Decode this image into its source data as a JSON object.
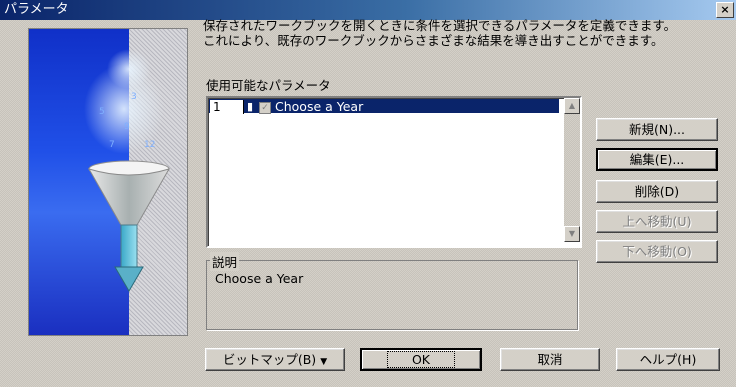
{
  "window": {
    "title": "パラメータ",
    "close_glyph": "×"
  },
  "description": {
    "line1": "保存されたワークブックを開くときに条件を選択できるパラメータを定義できます。",
    "line2": "これにより、既存のワークブックからさまざまな結果を導き出すことができます。"
  },
  "params_list": {
    "label": "使用可能なパラメータ",
    "rows": [
      {
        "number": "1",
        "name": "Choose a Year",
        "checked": true
      }
    ],
    "scroll_up_glyph": "▲",
    "scroll_down_glyph": "▼"
  },
  "explanation": {
    "label": "説明",
    "text": "Choose a Year"
  },
  "side_buttons": {
    "new": "新規(N)...",
    "edit": "編集(E)...",
    "delete": "削除(D)",
    "move_up": "上へ移動(U)",
    "move_down": "下へ移動(O)"
  },
  "bottom_buttons": {
    "bitmap": "ビットマップ(B)",
    "bitmap_arrow": "▼",
    "ok": "OK",
    "cancel": "取消",
    "help": "ヘルプ(H)"
  },
  "colors": {
    "titlebar_start": "#0a246a",
    "titlebar_end": "#a6caf0",
    "face": "#d4d0c8",
    "selection": "#0a246a",
    "art_blue": "#2050e8"
  },
  "icons": [
    "funnel-illustration",
    "close-icon",
    "scroll-up-icon",
    "scroll-down-icon",
    "dropdown-arrow-icon"
  ]
}
